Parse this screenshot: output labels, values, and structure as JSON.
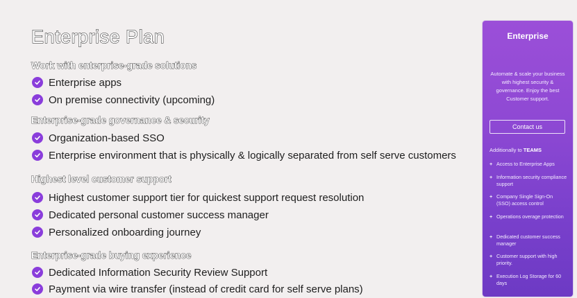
{
  "title": "Enterprise Plan",
  "sections": [
    {
      "heading": "Work with enterprise-grade solutions",
      "items": [
        "Enterprise apps",
        "On premise connectivity (upcoming)"
      ]
    },
    {
      "heading": "Enterprise-grade governance & security",
      "items": [
        "Organization-based SSO",
        "Enterprise environment that is physically & logically separated from self serve customers"
      ]
    },
    {
      "heading": "Highest level customer support",
      "items": [
        "Highest customer support tier for quickest support request resolution",
        "Dedicated personal customer success manager",
        "Personalized onboarding journey"
      ]
    },
    {
      "heading": "Enterprise-grade buying experience",
      "items": [
        "Dedicated Information Security Review Support",
        "Payment via wire transfer (instead of credit card for self serve plans)"
      ]
    }
  ],
  "card": {
    "title": "Enterprise",
    "description": "Automate & scale your business with highest security & governance. Enjoy the best Customer support.",
    "contact_label": "Contact us",
    "additionally_prefix": "Additionally to ",
    "additionally_bold": "TEAMS",
    "features": [
      "Access to Enterprise Apps",
      "Information security compliance support",
      "Company Single Sign-On (SSO) access control",
      "Operations overage protection",
      "Dedicated customer success manager",
      "Customer support with high priority.",
      "Execution Log Storage for 60 days"
    ]
  },
  "colors": {
    "accent": "#8a3ddb",
    "card_top": "#9b4fd8",
    "card_bottom": "#6d3ac4"
  },
  "icons": {
    "check": "check-circle-icon",
    "plus": "plus-icon"
  }
}
